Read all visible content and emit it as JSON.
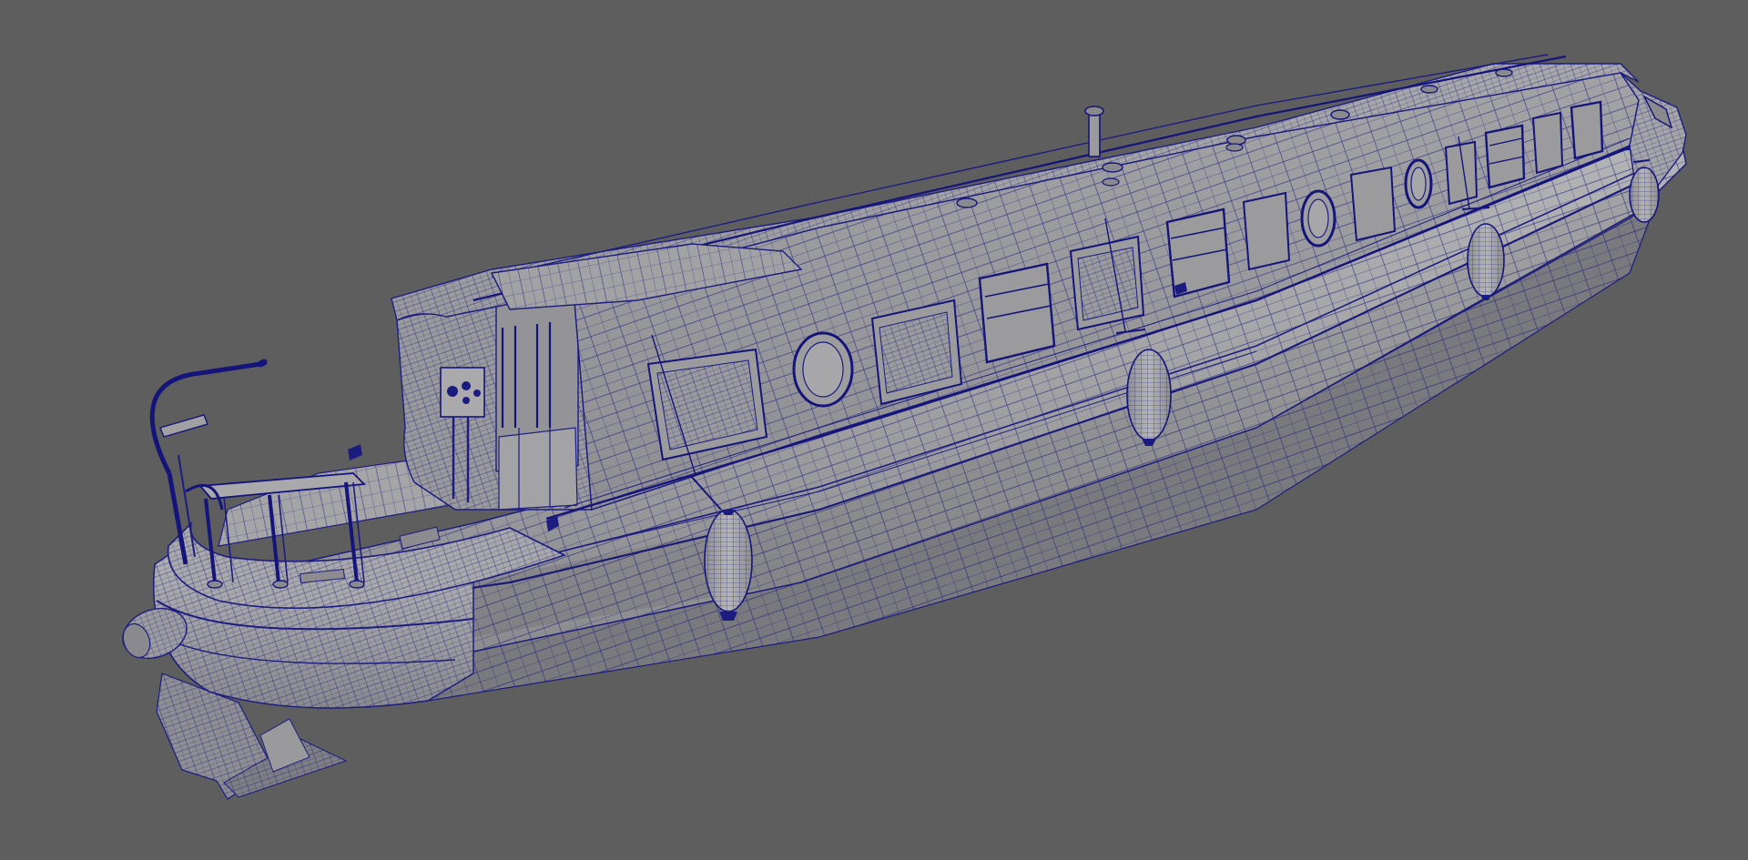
{
  "viewport": {
    "background": "#5e5e5e",
    "object": "narrowboat-mesh",
    "display_mode": "wireframe-on-shaded",
    "colors": {
      "surface_light": "#a7a7a9",
      "surface_mid": "#98989b",
      "surface_shadow": "#7f7f83",
      "surface_dark": "#6a6a6e",
      "wire": "#1c1c80",
      "wire_heavy": "#14147a"
    }
  }
}
